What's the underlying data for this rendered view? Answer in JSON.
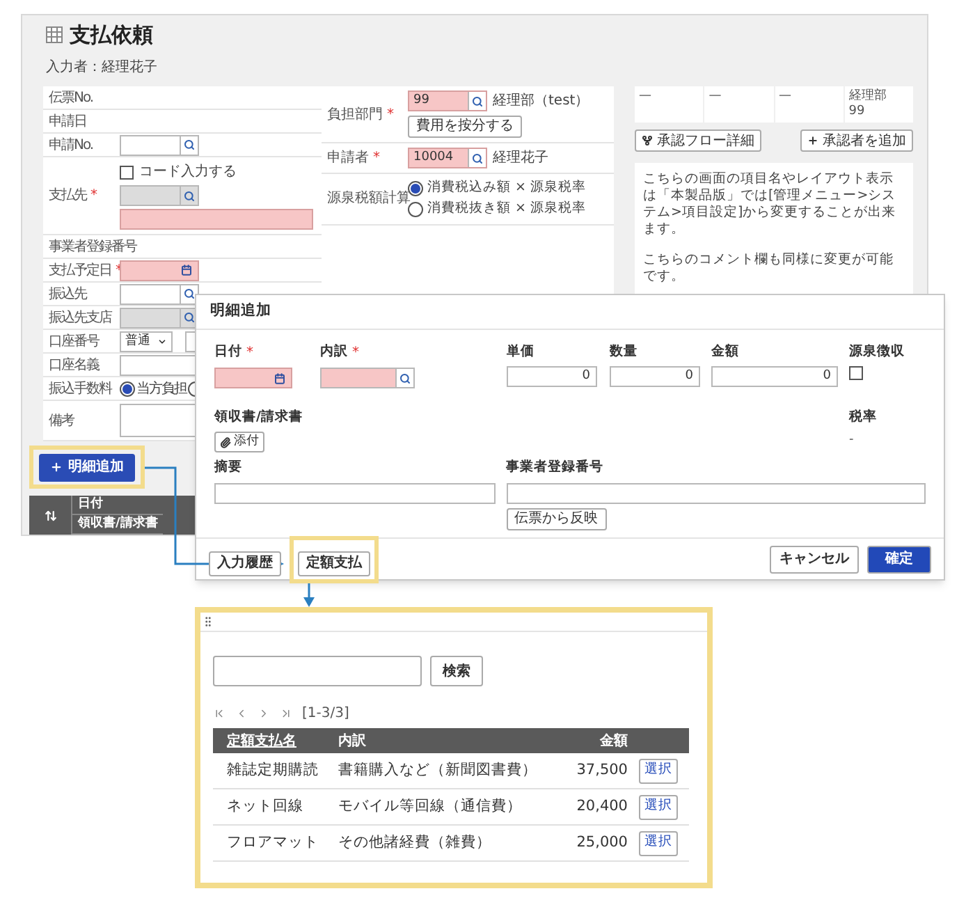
{
  "required_mark": "*",
  "header": {
    "title": "支払依頼",
    "entered_by": "入力者：経理花子"
  },
  "left_form": [
    {
      "kind": "label",
      "label": "伝票No."
    },
    {
      "kind": "label",
      "label": "申請日"
    },
    {
      "kind": "search",
      "label": "申請No."
    },
    {
      "kind": "payee",
      "label": "支払先",
      "required": true,
      "checkbox": {
        "label": "コード入力する",
        "checked": false
      }
    },
    {
      "kind": "label",
      "label": "事業者登録番号"
    },
    {
      "kind": "date",
      "label": "支払予定日",
      "required": true
    },
    {
      "kind": "search",
      "label": "振込先"
    },
    {
      "kind": "search_disabled",
      "label": "振込先支店"
    },
    {
      "kind": "account",
      "label": "口座番号",
      "value": "普通"
    },
    {
      "kind": "input",
      "label": "口座名義"
    },
    {
      "kind": "radio",
      "label": "振込手数料",
      "options": [
        {
          "label": "当方負担",
          "selected": true
        },
        {
          "selected": false
        }
      ]
    },
    {
      "kind": "textarea",
      "label": "備考"
    }
  ],
  "middle_form": [
    {
      "kind": "lookup",
      "label": "負担部門",
      "required": true,
      "value": "99",
      "name": "経理部（test）",
      "button": "費用を按分する"
    },
    {
      "kind": "lookup",
      "label": "申請者",
      "required": true,
      "value": "10004",
      "name": "経理花子"
    },
    {
      "kind": "radio",
      "label": "源泉税額計算",
      "options": [
        {
          "label": "消費税込み額 × 源泉税率",
          "selected": true
        },
        {
          "label": "消費税抜き額 × 源泉税率",
          "selected": false
        }
      ]
    }
  ],
  "approval": {
    "cells": [
      {
        "lines": [
          "—"
        ]
      },
      {
        "lines": [
          "—"
        ]
      },
      {
        "lines": [
          "—"
        ]
      },
      {
        "lines": [
          "経理部",
          "99"
        ]
      }
    ],
    "flow_button": "承認フロー詳細",
    "add_button": "承認者を追加",
    "comments": [
      "こちらの画面の項目名やレイアウト表示は「本製品版」では[管理メニュー>システム>項目設定]から変更することが出来ます。",
      "こちらのコメント欄も同様に変更が可能です。"
    ]
  },
  "add_line_button": "明細追加",
  "detail_table": {
    "columns": [
      "日付",
      "領収書/請求書"
    ]
  },
  "dialog": {
    "title": "明細追加",
    "fields": [
      {
        "kind": "date",
        "label": "日付",
        "required": true
      },
      {
        "kind": "search",
        "label": "内訳",
        "required": true
      },
      {
        "kind": "number",
        "label": "単価",
        "value": "0"
      },
      {
        "kind": "number",
        "label": "数量",
        "value": "0"
      },
      {
        "kind": "number",
        "label": "金額",
        "value": "0"
      },
      {
        "kind": "checkbox",
        "label": "源泉徴収",
        "checked": false
      }
    ],
    "receipt": {
      "label": "領収書/請求書",
      "button": "添付"
    },
    "tax_rate": {
      "label": "税率",
      "value": "-"
    },
    "summary": {
      "label": "摘要"
    },
    "registration": {
      "label": "事業者登録番号",
      "button": "伝票から反映"
    },
    "footer_left": [
      {
        "label": "入力履歴",
        "highlighted": false
      },
      {
        "label": "定額支払",
        "highlighted": true
      }
    ],
    "footer_right": [
      {
        "label": "キャンセル",
        "kind": "default"
      },
      {
        "label": "確定",
        "kind": "primary"
      }
    ]
  },
  "callout": {
    "search_button": "検索",
    "pager_text": "[1-3/3]",
    "columns": [
      "定額支払名",
      "内訳",
      "金額"
    ],
    "rows": [
      {
        "name": "雑誌定期購読",
        "breakdown": "書籍購入など（新聞図書費）",
        "amount": "37,500",
        "button": "選択"
      },
      {
        "name": "ネット回線",
        "breakdown": "モバイル等回線（通信費）",
        "amount": "20,400",
        "button": "選択"
      },
      {
        "name": "フロアマット",
        "breakdown": "その他諸経費（雑費）",
        "amount": "25,000",
        "button": "選択"
      }
    ]
  }
}
